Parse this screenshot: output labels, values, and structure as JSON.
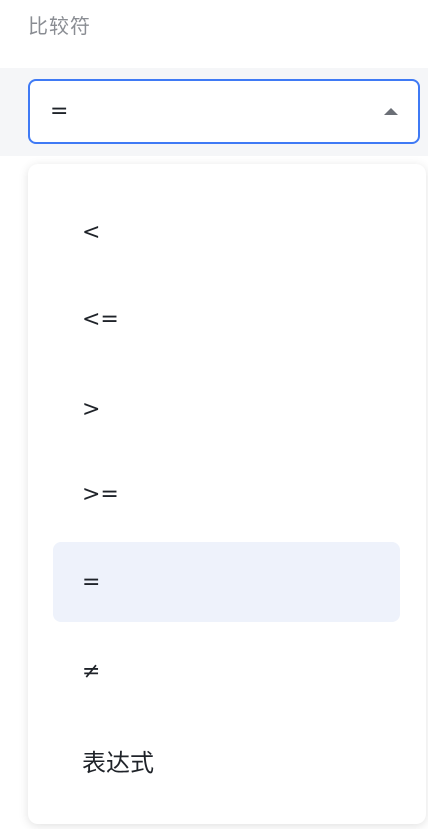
{
  "field": {
    "label": "比较符"
  },
  "select": {
    "value": "=",
    "caret_icon": "caret-up-icon"
  },
  "dropdown": {
    "options": [
      {
        "label": "<",
        "selected": false
      },
      {
        "label": "<=",
        "selected": false
      },
      {
        "label": ">",
        "selected": false
      },
      {
        "label": ">=",
        "selected": false
      },
      {
        "label": "=",
        "selected": true
      },
      {
        "label": "≠",
        "selected": false
      },
      {
        "label": "表达式",
        "selected": false
      }
    ]
  },
  "colors": {
    "accent_border": "#3f7af5",
    "selected_background": "#eef2fb",
    "label_text": "#8a8d93"
  }
}
